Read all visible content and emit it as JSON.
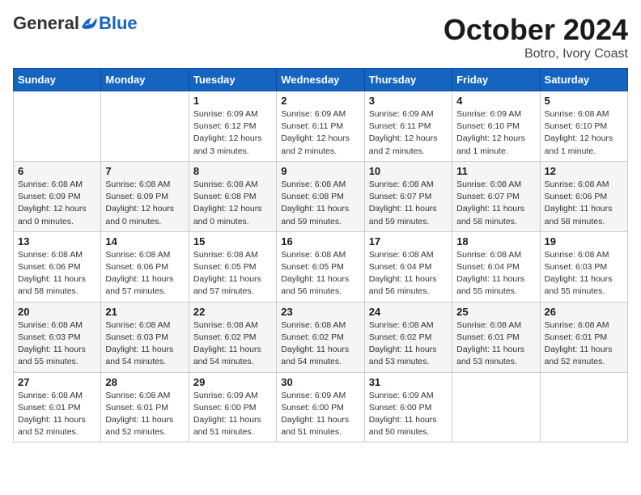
{
  "header": {
    "logo_general": "General",
    "logo_blue": "Blue",
    "month": "October 2024",
    "location": "Botro, Ivory Coast"
  },
  "weekdays": [
    "Sunday",
    "Monday",
    "Tuesday",
    "Wednesday",
    "Thursday",
    "Friday",
    "Saturday"
  ],
  "weeks": [
    [
      {
        "day": "",
        "info": ""
      },
      {
        "day": "",
        "info": ""
      },
      {
        "day": "1",
        "info": "Sunrise: 6:09 AM\nSunset: 6:12 PM\nDaylight: 12 hours and 3 minutes."
      },
      {
        "day": "2",
        "info": "Sunrise: 6:09 AM\nSunset: 6:11 PM\nDaylight: 12 hours and 2 minutes."
      },
      {
        "day": "3",
        "info": "Sunrise: 6:09 AM\nSunset: 6:11 PM\nDaylight: 12 hours and 2 minutes."
      },
      {
        "day": "4",
        "info": "Sunrise: 6:09 AM\nSunset: 6:10 PM\nDaylight: 12 hours and 1 minute."
      },
      {
        "day": "5",
        "info": "Sunrise: 6:08 AM\nSunset: 6:10 PM\nDaylight: 12 hours and 1 minute."
      }
    ],
    [
      {
        "day": "6",
        "info": "Sunrise: 6:08 AM\nSunset: 6:09 PM\nDaylight: 12 hours and 0 minutes."
      },
      {
        "day": "7",
        "info": "Sunrise: 6:08 AM\nSunset: 6:09 PM\nDaylight: 12 hours and 0 minutes."
      },
      {
        "day": "8",
        "info": "Sunrise: 6:08 AM\nSunset: 6:08 PM\nDaylight: 12 hours and 0 minutes."
      },
      {
        "day": "9",
        "info": "Sunrise: 6:08 AM\nSunset: 6:08 PM\nDaylight: 11 hours and 59 minutes."
      },
      {
        "day": "10",
        "info": "Sunrise: 6:08 AM\nSunset: 6:07 PM\nDaylight: 11 hours and 59 minutes."
      },
      {
        "day": "11",
        "info": "Sunrise: 6:08 AM\nSunset: 6:07 PM\nDaylight: 11 hours and 58 minutes."
      },
      {
        "day": "12",
        "info": "Sunrise: 6:08 AM\nSunset: 6:06 PM\nDaylight: 11 hours and 58 minutes."
      }
    ],
    [
      {
        "day": "13",
        "info": "Sunrise: 6:08 AM\nSunset: 6:06 PM\nDaylight: 11 hours and 58 minutes."
      },
      {
        "day": "14",
        "info": "Sunrise: 6:08 AM\nSunset: 6:06 PM\nDaylight: 11 hours and 57 minutes."
      },
      {
        "day": "15",
        "info": "Sunrise: 6:08 AM\nSunset: 6:05 PM\nDaylight: 11 hours and 57 minutes."
      },
      {
        "day": "16",
        "info": "Sunrise: 6:08 AM\nSunset: 6:05 PM\nDaylight: 11 hours and 56 minutes."
      },
      {
        "day": "17",
        "info": "Sunrise: 6:08 AM\nSunset: 6:04 PM\nDaylight: 11 hours and 56 minutes."
      },
      {
        "day": "18",
        "info": "Sunrise: 6:08 AM\nSunset: 6:04 PM\nDaylight: 11 hours and 55 minutes."
      },
      {
        "day": "19",
        "info": "Sunrise: 6:08 AM\nSunset: 6:03 PM\nDaylight: 11 hours and 55 minutes."
      }
    ],
    [
      {
        "day": "20",
        "info": "Sunrise: 6:08 AM\nSunset: 6:03 PM\nDaylight: 11 hours and 55 minutes."
      },
      {
        "day": "21",
        "info": "Sunrise: 6:08 AM\nSunset: 6:03 PM\nDaylight: 11 hours and 54 minutes."
      },
      {
        "day": "22",
        "info": "Sunrise: 6:08 AM\nSunset: 6:02 PM\nDaylight: 11 hours and 54 minutes."
      },
      {
        "day": "23",
        "info": "Sunrise: 6:08 AM\nSunset: 6:02 PM\nDaylight: 11 hours and 54 minutes."
      },
      {
        "day": "24",
        "info": "Sunrise: 6:08 AM\nSunset: 6:02 PM\nDaylight: 11 hours and 53 minutes."
      },
      {
        "day": "25",
        "info": "Sunrise: 6:08 AM\nSunset: 6:01 PM\nDaylight: 11 hours and 53 minutes."
      },
      {
        "day": "26",
        "info": "Sunrise: 6:08 AM\nSunset: 6:01 PM\nDaylight: 11 hours and 52 minutes."
      }
    ],
    [
      {
        "day": "27",
        "info": "Sunrise: 6:08 AM\nSunset: 6:01 PM\nDaylight: 11 hours and 52 minutes."
      },
      {
        "day": "28",
        "info": "Sunrise: 6:08 AM\nSunset: 6:01 PM\nDaylight: 11 hours and 52 minutes."
      },
      {
        "day": "29",
        "info": "Sunrise: 6:09 AM\nSunset: 6:00 PM\nDaylight: 11 hours and 51 minutes."
      },
      {
        "day": "30",
        "info": "Sunrise: 6:09 AM\nSunset: 6:00 PM\nDaylight: 11 hours and 51 minutes."
      },
      {
        "day": "31",
        "info": "Sunrise: 6:09 AM\nSunset: 6:00 PM\nDaylight: 11 hours and 50 minutes."
      },
      {
        "day": "",
        "info": ""
      },
      {
        "day": "",
        "info": ""
      }
    ]
  ]
}
